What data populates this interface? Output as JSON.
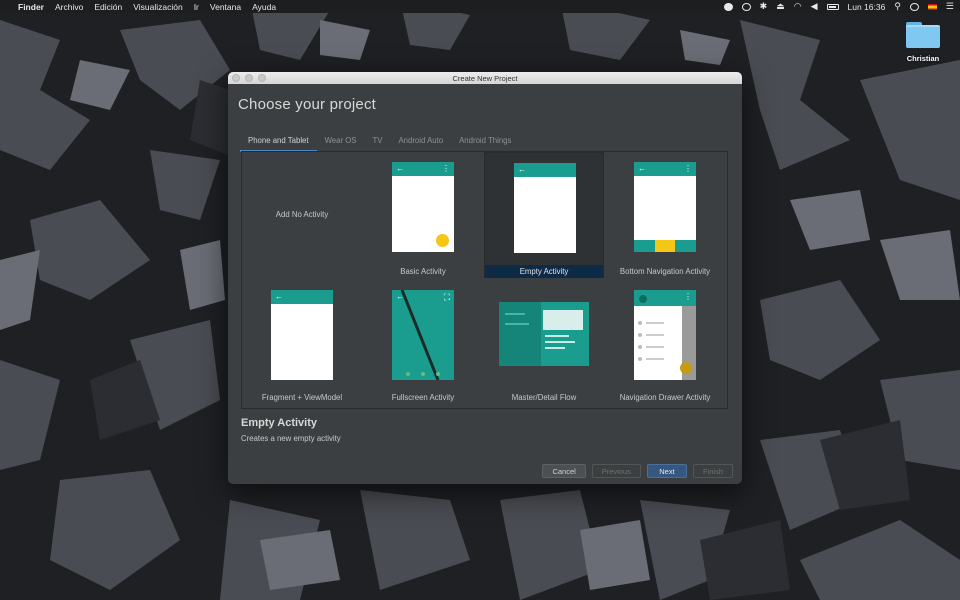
{
  "colors": {
    "accent_teal": "#1a9d8f",
    "fab_yellow": "#f5c518",
    "selection_blue": "#0d2b47",
    "primary_button": "#365880"
  },
  "menubar": {
    "items": [
      "Finder",
      "Archivo",
      "Edición",
      "Visualización",
      "Ir",
      "Ventana",
      "Ayuda"
    ],
    "clock": "Lun 16:36"
  },
  "desktop": {
    "folder_label": "Christian"
  },
  "window": {
    "title": "Create New Project",
    "heading": "Choose your project",
    "tabs": [
      "Phone and Tablet",
      "Wear OS",
      "TV",
      "Android Auto",
      "Android Things"
    ],
    "active_tab": "Phone and Tablet",
    "templates": [
      "Add No Activity",
      "Basic Activity",
      "Empty Activity",
      "Bottom Navigation Activity",
      "Fragment + ViewModel",
      "Fullscreen Activity",
      "Master/Detail Flow",
      "Navigation Drawer Activity"
    ],
    "selected_template": "Empty Activity",
    "description_title": "Empty Activity",
    "description_text": "Creates a new empty activity",
    "buttons": {
      "cancel": "Cancel",
      "previous": "Previous",
      "next": "Next",
      "finish": "Finish"
    }
  }
}
